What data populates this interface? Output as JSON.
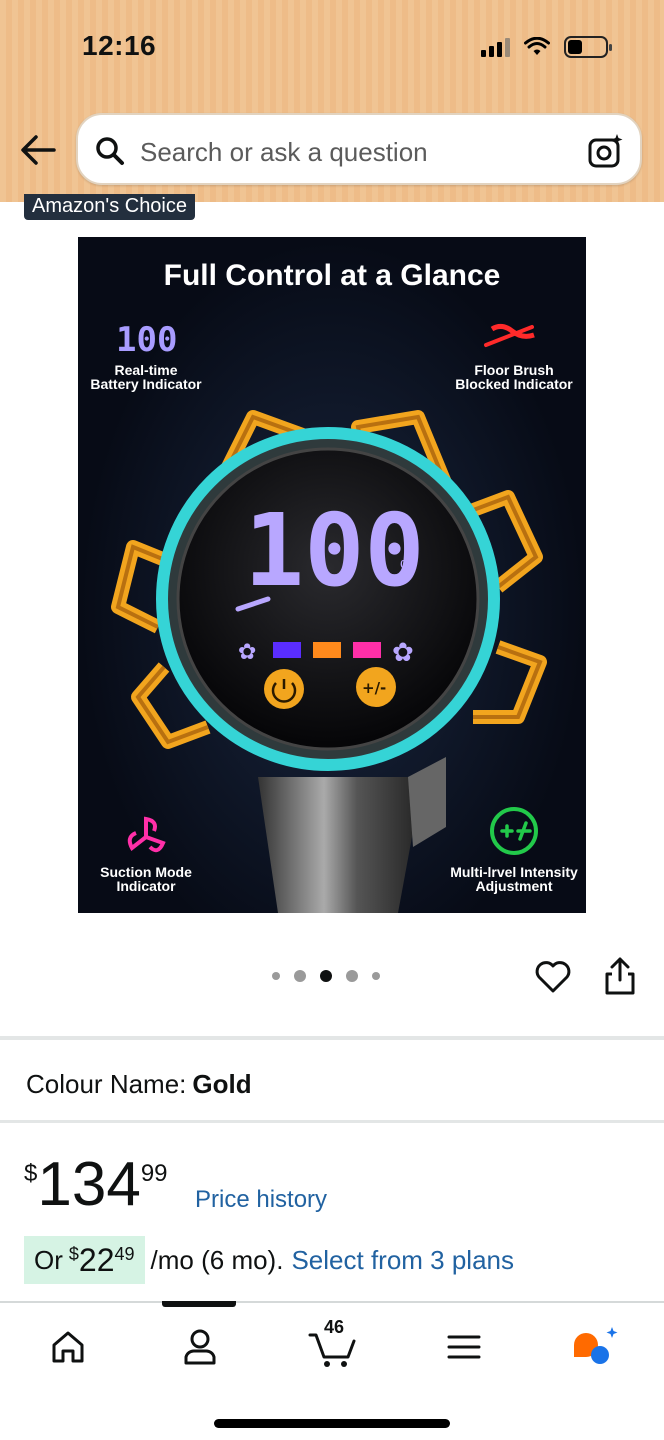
{
  "status_bar": {
    "time": "12:16"
  },
  "search": {
    "placeholder": "Search or ask a question"
  },
  "badge": "Amazon's Choice",
  "product_image": {
    "title": "Full Control at a Glance",
    "battery_display": "100",
    "labels": {
      "top_left": [
        "Real-time",
        "Battery Indicator"
      ],
      "top_right": [
        "Floor Brush",
        "Blocked Indicator"
      ],
      "bottom_left": [
        "Suction Mode",
        "Indicator"
      ],
      "bottom_right": [
        "Multi-lrvel Intensity",
        "Adjustment"
      ]
    },
    "accent_colors": {
      "ring": "#35d4d6",
      "gold": "#f2a51e",
      "purple_display": "#b8a7ff",
      "pink": "#ff2fa8",
      "green": "#22c94a"
    }
  },
  "carousel": {
    "count": 5,
    "active_index": 2
  },
  "colour": {
    "label": "Colour Name:",
    "value": "Gold"
  },
  "price": {
    "symbol": "$",
    "whole": "134",
    "fraction": "99",
    "history_link": "Price history"
  },
  "installment": {
    "prefix": "Or",
    "symbol": "$",
    "whole": "22",
    "fraction": "49",
    "suffix": "/mo (6 mo).",
    "link": "Select from 3 plans"
  },
  "bottom_nav": {
    "items": [
      "home-icon",
      "account-icon",
      "cart-icon",
      "menu-icon",
      "rufus-icon"
    ],
    "cart_count": "46"
  }
}
